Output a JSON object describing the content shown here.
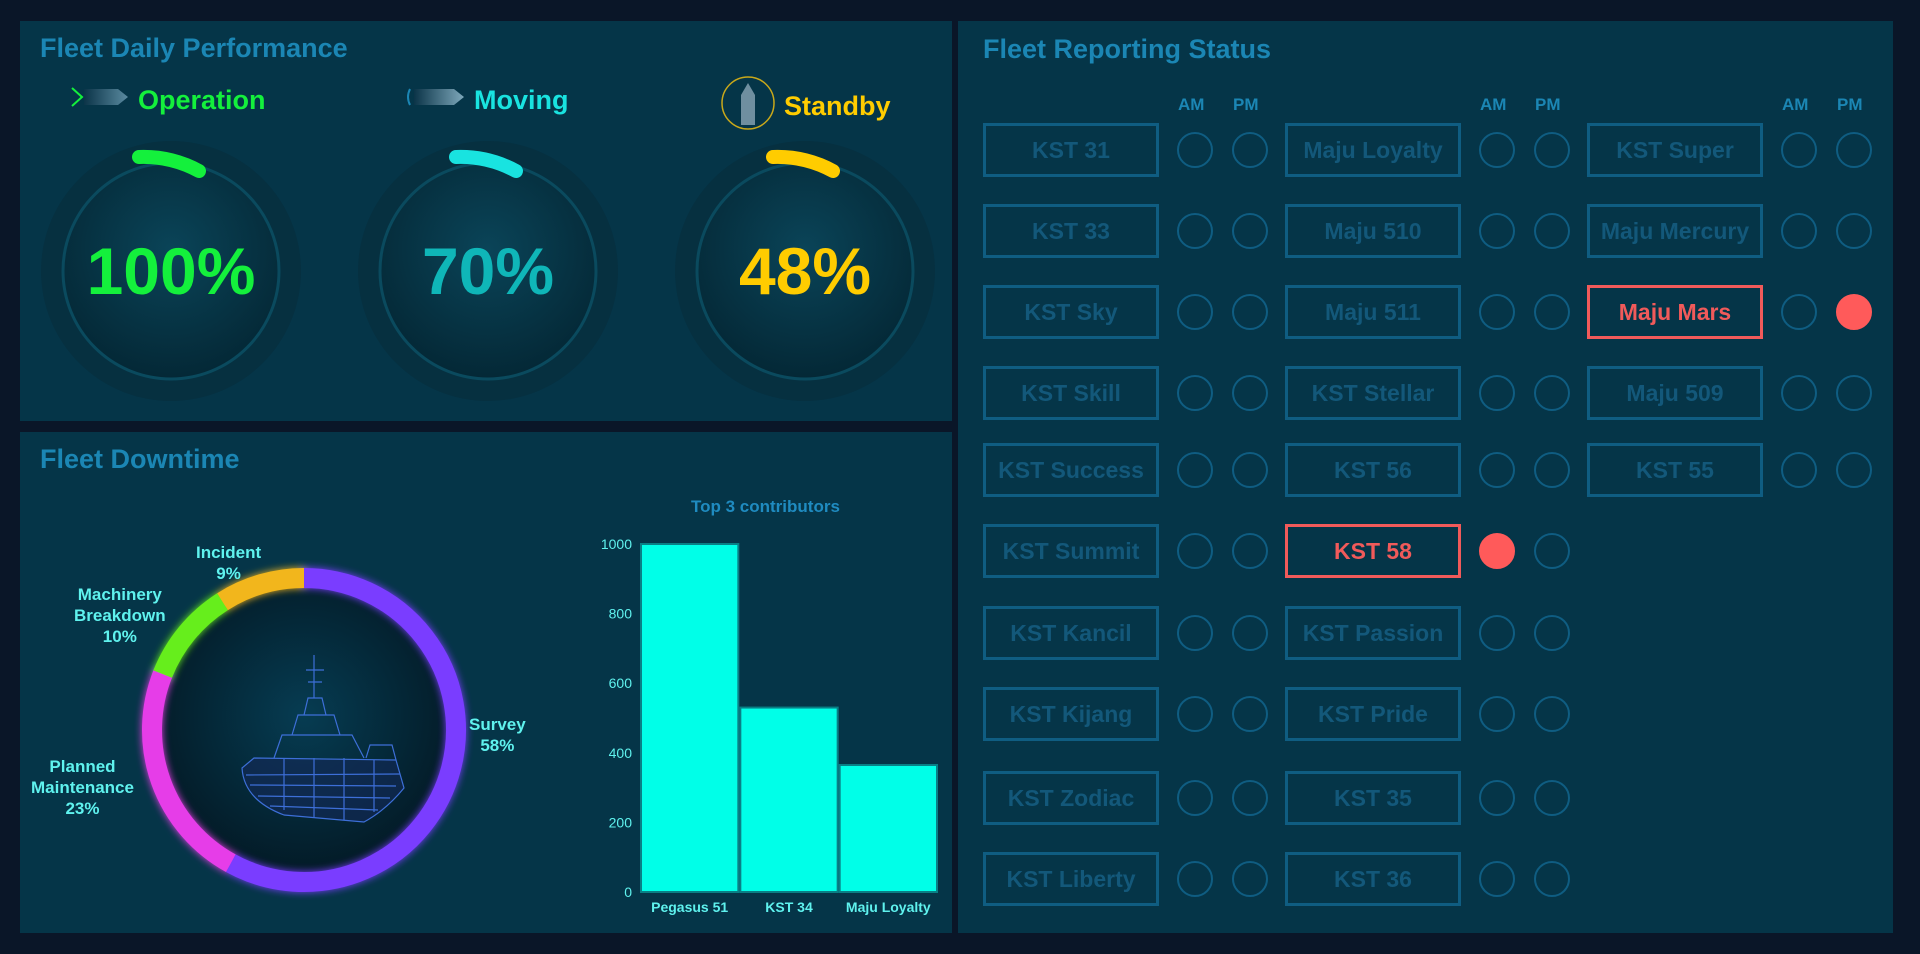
{
  "colors": {
    "background": "#0a1628",
    "panel": "#053548",
    "title": "#1b86b4",
    "operation": "#14f03c",
    "moving": "#19e3e0",
    "standby": "#ffcc00",
    "alert": "#f15a5a",
    "bar": "#00ffe8"
  },
  "performance": {
    "title": "Fleet Daily Performance",
    "gauges": [
      {
        "label": "Operation",
        "value": "100%",
        "icon": "chevron-arrow-icon",
        "color": "#14f03c",
        "text_color": "#14f03c"
      },
      {
        "label": "Moving",
        "value": "70%",
        "icon": "motion-arrow-icon",
        "color": "#19e3e0",
        "text_color": "#0fb6b8"
      },
      {
        "label": "Standby",
        "value": "48%",
        "icon": "anchored-ship-icon",
        "color": "#ffcc00",
        "text_color": "#ffcc00"
      }
    ]
  },
  "downtime": {
    "title": "Fleet Downtime",
    "donut": [
      {
        "name": "Survey",
        "pct_label": "58%",
        "value": 58,
        "color": "#7a3cff"
      },
      {
        "name": "Planned Maintenance",
        "pct_label": "23%",
        "value": 23,
        "color": "#e63ee8"
      },
      {
        "name": "Machinery Breakdown",
        "pct_label": "10%",
        "value": 10,
        "color": "#66ee1a"
      },
      {
        "name": "Incident",
        "pct_label": "9%",
        "value": 9,
        "color": "#f2b61a"
      }
    ],
    "labels": {
      "incident_line1": "Incident",
      "incident_line2": "9%",
      "machinery_line1": "Machinery",
      "machinery_line2": "Breakdown",
      "machinery_line3": "10%",
      "planned_line1": "Planned",
      "planned_line2": "Maintenance",
      "planned_line3": "23%",
      "survey_line1": "Survey",
      "survey_line2": "58%"
    }
  },
  "chart_data": {
    "type": "bar",
    "title": "Top 3 contributors",
    "categories": [
      "Pegasus 51",
      "KST 34",
      "Maju Loyalty"
    ],
    "values": [
      1000,
      530,
      365
    ],
    "ylim": [
      0,
      1000
    ],
    "yticks": [
      0,
      200,
      400,
      600,
      800,
      1000
    ],
    "xlabel": "",
    "ylabel": ""
  },
  "reporting": {
    "title": "Fleet Reporting Status",
    "am_label": "AM",
    "pm_label": "PM",
    "columns": [
      [
        {
          "name": "KST 31",
          "am": false,
          "pm": false,
          "alert": false
        },
        {
          "name": "KST 33",
          "am": false,
          "pm": false,
          "alert": false
        },
        {
          "name": "KST Sky",
          "am": false,
          "pm": false,
          "alert": false
        },
        {
          "name": "KST Skill",
          "am": false,
          "pm": false,
          "alert": false
        },
        {
          "name": "KST Success",
          "am": false,
          "pm": false,
          "alert": false
        },
        {
          "name": "KST Summit",
          "am": false,
          "pm": false,
          "alert": false
        },
        {
          "name": "KST Kancil",
          "am": false,
          "pm": false,
          "alert": false
        },
        {
          "name": "KST Kijang",
          "am": false,
          "pm": false,
          "alert": false
        },
        {
          "name": "KST Zodiac",
          "am": false,
          "pm": false,
          "alert": false
        },
        {
          "name": "KST Liberty",
          "am": false,
          "pm": false,
          "alert": false
        }
      ],
      [
        {
          "name": "Maju Loyalty",
          "am": false,
          "pm": false,
          "alert": false
        },
        {
          "name": "Maju 510",
          "am": false,
          "pm": false,
          "alert": false
        },
        {
          "name": "Maju 511",
          "am": false,
          "pm": false,
          "alert": false
        },
        {
          "name": "KST Stellar",
          "am": false,
          "pm": false,
          "alert": false
        },
        {
          "name": "KST 56",
          "am": false,
          "pm": false,
          "alert": false
        },
        {
          "name": "KST 58",
          "am": true,
          "pm": false,
          "alert": true
        },
        {
          "name": "KST Passion",
          "am": false,
          "pm": false,
          "alert": false
        },
        {
          "name": "KST Pride",
          "am": false,
          "pm": false,
          "alert": false
        },
        {
          "name": "KST 35",
          "am": false,
          "pm": false,
          "alert": false
        },
        {
          "name": "KST 36",
          "am": false,
          "pm": false,
          "alert": false
        }
      ],
      [
        {
          "name": "KST Super",
          "am": false,
          "pm": false,
          "alert": false
        },
        {
          "name": "Maju Mercury",
          "am": false,
          "pm": false,
          "alert": false
        },
        {
          "name": "Maju Mars",
          "am": false,
          "pm": true,
          "alert": true
        },
        {
          "name": "Maju 509",
          "am": false,
          "pm": false,
          "alert": false
        },
        {
          "name": "KST 55",
          "am": false,
          "pm": false,
          "alert": false
        }
      ]
    ]
  }
}
